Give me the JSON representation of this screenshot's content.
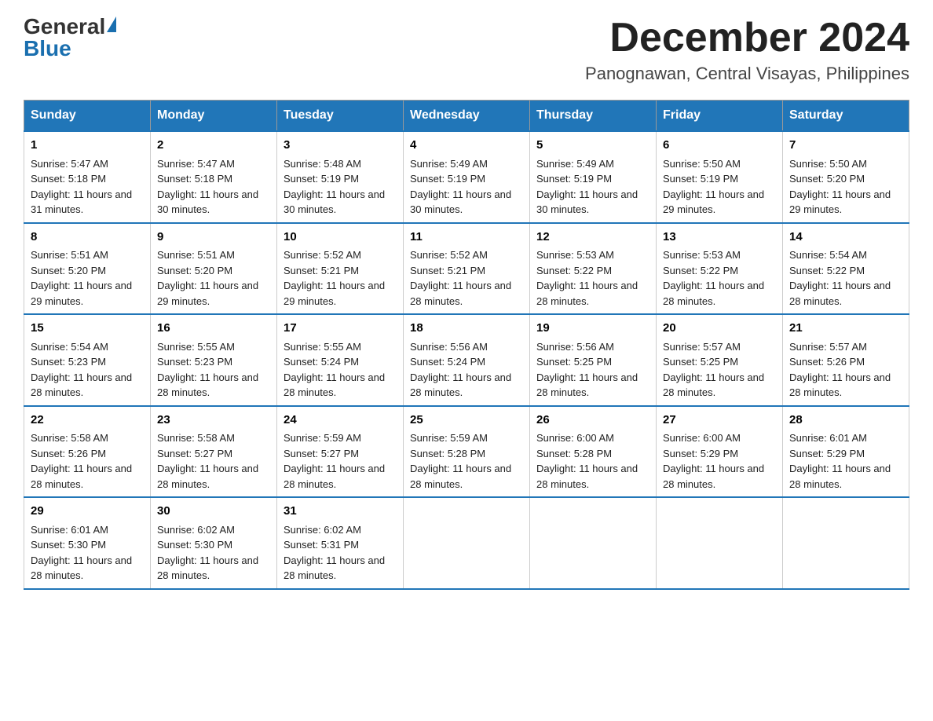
{
  "header": {
    "logo_general": "General",
    "logo_blue": "Blue",
    "month_title": "December 2024",
    "location": "Panognawan, Central Visayas, Philippines"
  },
  "days_of_week": [
    "Sunday",
    "Monday",
    "Tuesday",
    "Wednesday",
    "Thursday",
    "Friday",
    "Saturday"
  ],
  "weeks": [
    [
      {
        "day": "1",
        "sunrise": "5:47 AM",
        "sunset": "5:18 PM",
        "daylight": "11 hours and 31 minutes."
      },
      {
        "day": "2",
        "sunrise": "5:47 AM",
        "sunset": "5:18 PM",
        "daylight": "11 hours and 30 minutes."
      },
      {
        "day": "3",
        "sunrise": "5:48 AM",
        "sunset": "5:19 PM",
        "daylight": "11 hours and 30 minutes."
      },
      {
        "day": "4",
        "sunrise": "5:49 AM",
        "sunset": "5:19 PM",
        "daylight": "11 hours and 30 minutes."
      },
      {
        "day": "5",
        "sunrise": "5:49 AM",
        "sunset": "5:19 PM",
        "daylight": "11 hours and 30 minutes."
      },
      {
        "day": "6",
        "sunrise": "5:50 AM",
        "sunset": "5:19 PM",
        "daylight": "11 hours and 29 minutes."
      },
      {
        "day": "7",
        "sunrise": "5:50 AM",
        "sunset": "5:20 PM",
        "daylight": "11 hours and 29 minutes."
      }
    ],
    [
      {
        "day": "8",
        "sunrise": "5:51 AM",
        "sunset": "5:20 PM",
        "daylight": "11 hours and 29 minutes."
      },
      {
        "day": "9",
        "sunrise": "5:51 AM",
        "sunset": "5:20 PM",
        "daylight": "11 hours and 29 minutes."
      },
      {
        "day": "10",
        "sunrise": "5:52 AM",
        "sunset": "5:21 PM",
        "daylight": "11 hours and 29 minutes."
      },
      {
        "day": "11",
        "sunrise": "5:52 AM",
        "sunset": "5:21 PM",
        "daylight": "11 hours and 28 minutes."
      },
      {
        "day": "12",
        "sunrise": "5:53 AM",
        "sunset": "5:22 PM",
        "daylight": "11 hours and 28 minutes."
      },
      {
        "day": "13",
        "sunrise": "5:53 AM",
        "sunset": "5:22 PM",
        "daylight": "11 hours and 28 minutes."
      },
      {
        "day": "14",
        "sunrise": "5:54 AM",
        "sunset": "5:22 PM",
        "daylight": "11 hours and 28 minutes."
      }
    ],
    [
      {
        "day": "15",
        "sunrise": "5:54 AM",
        "sunset": "5:23 PM",
        "daylight": "11 hours and 28 minutes."
      },
      {
        "day": "16",
        "sunrise": "5:55 AM",
        "sunset": "5:23 PM",
        "daylight": "11 hours and 28 minutes."
      },
      {
        "day": "17",
        "sunrise": "5:55 AM",
        "sunset": "5:24 PM",
        "daylight": "11 hours and 28 minutes."
      },
      {
        "day": "18",
        "sunrise": "5:56 AM",
        "sunset": "5:24 PM",
        "daylight": "11 hours and 28 minutes."
      },
      {
        "day": "19",
        "sunrise": "5:56 AM",
        "sunset": "5:25 PM",
        "daylight": "11 hours and 28 minutes."
      },
      {
        "day": "20",
        "sunrise": "5:57 AM",
        "sunset": "5:25 PM",
        "daylight": "11 hours and 28 minutes."
      },
      {
        "day": "21",
        "sunrise": "5:57 AM",
        "sunset": "5:26 PM",
        "daylight": "11 hours and 28 minutes."
      }
    ],
    [
      {
        "day": "22",
        "sunrise": "5:58 AM",
        "sunset": "5:26 PM",
        "daylight": "11 hours and 28 minutes."
      },
      {
        "day": "23",
        "sunrise": "5:58 AM",
        "sunset": "5:27 PM",
        "daylight": "11 hours and 28 minutes."
      },
      {
        "day": "24",
        "sunrise": "5:59 AM",
        "sunset": "5:27 PM",
        "daylight": "11 hours and 28 minutes."
      },
      {
        "day": "25",
        "sunrise": "5:59 AM",
        "sunset": "5:28 PM",
        "daylight": "11 hours and 28 minutes."
      },
      {
        "day": "26",
        "sunrise": "6:00 AM",
        "sunset": "5:28 PM",
        "daylight": "11 hours and 28 minutes."
      },
      {
        "day": "27",
        "sunrise": "6:00 AM",
        "sunset": "5:29 PM",
        "daylight": "11 hours and 28 minutes."
      },
      {
        "day": "28",
        "sunrise": "6:01 AM",
        "sunset": "5:29 PM",
        "daylight": "11 hours and 28 minutes."
      }
    ],
    [
      {
        "day": "29",
        "sunrise": "6:01 AM",
        "sunset": "5:30 PM",
        "daylight": "11 hours and 28 minutes."
      },
      {
        "day": "30",
        "sunrise": "6:02 AM",
        "sunset": "5:30 PM",
        "daylight": "11 hours and 28 minutes."
      },
      {
        "day": "31",
        "sunrise": "6:02 AM",
        "sunset": "5:31 PM",
        "daylight": "11 hours and 28 minutes."
      },
      null,
      null,
      null,
      null
    ]
  ],
  "labels": {
    "sunrise": "Sunrise: ",
    "sunset": "Sunset: ",
    "daylight": "Daylight: "
  }
}
